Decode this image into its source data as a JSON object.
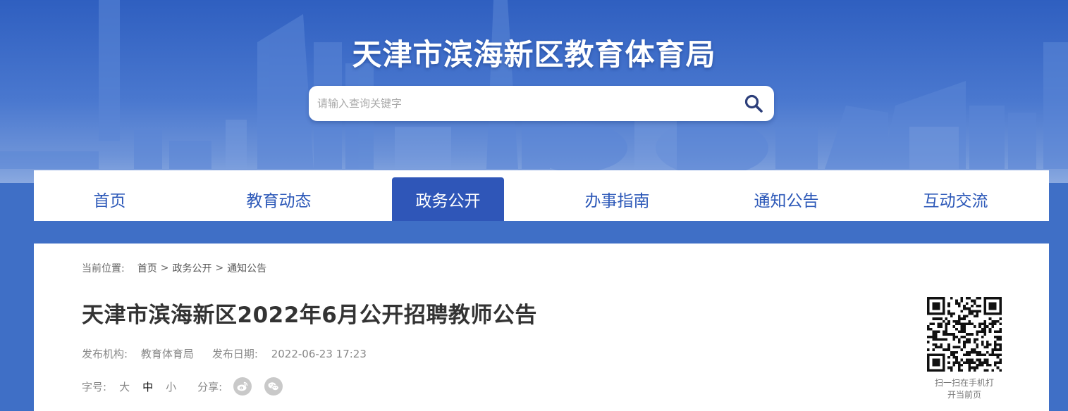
{
  "header": {
    "site_title": "天津市滨海新区教育体育局",
    "search": {
      "placeholder": "请输入查询关键字",
      "value": ""
    }
  },
  "nav": {
    "items": [
      {
        "label": "首页"
      },
      {
        "label": "教育动态"
      },
      {
        "label": "政务公开"
      },
      {
        "label": "办事指南"
      },
      {
        "label": "通知公告"
      },
      {
        "label": "互动交流"
      }
    ],
    "active": "政务公开"
  },
  "breadcrumb": {
    "label": "当前位置:",
    "items": [
      "首页",
      "政务公开",
      "通知公告"
    ],
    "separator": ">"
  },
  "article": {
    "title": "天津市滨海新区2022年6月公开招聘教师公告",
    "publisher_label": "发布机构:",
    "publisher": "教育体育局",
    "date_label": "发布日期:",
    "date": "2022-06-23 17:23"
  },
  "tools": {
    "font_size_label": "字号:",
    "font_sizes": [
      "大",
      "中",
      "小"
    ],
    "font_size_selected": "中",
    "share_label": "分享:",
    "share_icons": [
      "weibo-icon",
      "wechat-icon"
    ]
  },
  "qr": {
    "caption_line1": "扫一扫在手机打",
    "caption_line2": "开当前页"
  },
  "colors": {
    "nav_text": "#2c58b8",
    "nav_active_bg": "#2f56b8",
    "banner_blue": "#2f5fc0"
  }
}
